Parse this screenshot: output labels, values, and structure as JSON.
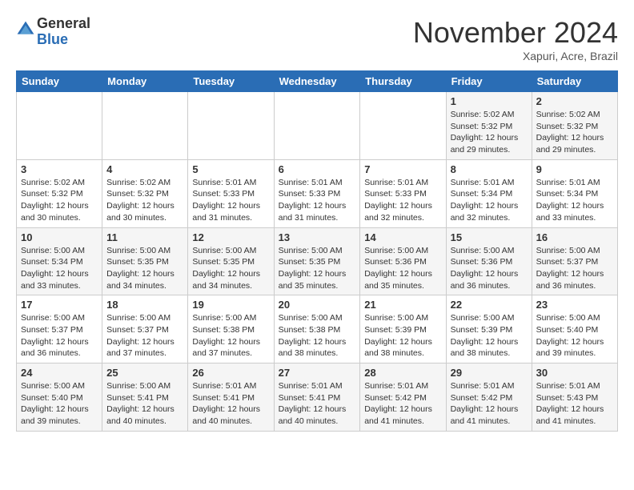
{
  "header": {
    "logo_general": "General",
    "logo_blue": "Blue",
    "month_title": "November 2024",
    "location": "Xapuri, Acre, Brazil"
  },
  "days_of_week": [
    "Sunday",
    "Monday",
    "Tuesday",
    "Wednesday",
    "Thursday",
    "Friday",
    "Saturday"
  ],
  "weeks": [
    [
      {
        "num": "",
        "info": ""
      },
      {
        "num": "",
        "info": ""
      },
      {
        "num": "",
        "info": ""
      },
      {
        "num": "",
        "info": ""
      },
      {
        "num": "",
        "info": ""
      },
      {
        "num": "1",
        "info": "Sunrise: 5:02 AM\nSunset: 5:32 PM\nDaylight: 12 hours and 29 minutes."
      },
      {
        "num": "2",
        "info": "Sunrise: 5:02 AM\nSunset: 5:32 PM\nDaylight: 12 hours and 29 minutes."
      }
    ],
    [
      {
        "num": "3",
        "info": "Sunrise: 5:02 AM\nSunset: 5:32 PM\nDaylight: 12 hours and 30 minutes."
      },
      {
        "num": "4",
        "info": "Sunrise: 5:02 AM\nSunset: 5:32 PM\nDaylight: 12 hours and 30 minutes."
      },
      {
        "num": "5",
        "info": "Sunrise: 5:01 AM\nSunset: 5:33 PM\nDaylight: 12 hours and 31 minutes."
      },
      {
        "num": "6",
        "info": "Sunrise: 5:01 AM\nSunset: 5:33 PM\nDaylight: 12 hours and 31 minutes."
      },
      {
        "num": "7",
        "info": "Sunrise: 5:01 AM\nSunset: 5:33 PM\nDaylight: 12 hours and 32 minutes."
      },
      {
        "num": "8",
        "info": "Sunrise: 5:01 AM\nSunset: 5:34 PM\nDaylight: 12 hours and 32 minutes."
      },
      {
        "num": "9",
        "info": "Sunrise: 5:01 AM\nSunset: 5:34 PM\nDaylight: 12 hours and 33 minutes."
      }
    ],
    [
      {
        "num": "10",
        "info": "Sunrise: 5:00 AM\nSunset: 5:34 PM\nDaylight: 12 hours and 33 minutes."
      },
      {
        "num": "11",
        "info": "Sunrise: 5:00 AM\nSunset: 5:35 PM\nDaylight: 12 hours and 34 minutes."
      },
      {
        "num": "12",
        "info": "Sunrise: 5:00 AM\nSunset: 5:35 PM\nDaylight: 12 hours and 34 minutes."
      },
      {
        "num": "13",
        "info": "Sunrise: 5:00 AM\nSunset: 5:35 PM\nDaylight: 12 hours and 35 minutes."
      },
      {
        "num": "14",
        "info": "Sunrise: 5:00 AM\nSunset: 5:36 PM\nDaylight: 12 hours and 35 minutes."
      },
      {
        "num": "15",
        "info": "Sunrise: 5:00 AM\nSunset: 5:36 PM\nDaylight: 12 hours and 36 minutes."
      },
      {
        "num": "16",
        "info": "Sunrise: 5:00 AM\nSunset: 5:37 PM\nDaylight: 12 hours and 36 minutes."
      }
    ],
    [
      {
        "num": "17",
        "info": "Sunrise: 5:00 AM\nSunset: 5:37 PM\nDaylight: 12 hours and 36 minutes."
      },
      {
        "num": "18",
        "info": "Sunrise: 5:00 AM\nSunset: 5:37 PM\nDaylight: 12 hours and 37 minutes."
      },
      {
        "num": "19",
        "info": "Sunrise: 5:00 AM\nSunset: 5:38 PM\nDaylight: 12 hours and 37 minutes."
      },
      {
        "num": "20",
        "info": "Sunrise: 5:00 AM\nSunset: 5:38 PM\nDaylight: 12 hours and 38 minutes."
      },
      {
        "num": "21",
        "info": "Sunrise: 5:00 AM\nSunset: 5:39 PM\nDaylight: 12 hours and 38 minutes."
      },
      {
        "num": "22",
        "info": "Sunrise: 5:00 AM\nSunset: 5:39 PM\nDaylight: 12 hours and 38 minutes."
      },
      {
        "num": "23",
        "info": "Sunrise: 5:00 AM\nSunset: 5:40 PM\nDaylight: 12 hours and 39 minutes."
      }
    ],
    [
      {
        "num": "24",
        "info": "Sunrise: 5:00 AM\nSunset: 5:40 PM\nDaylight: 12 hours and 39 minutes."
      },
      {
        "num": "25",
        "info": "Sunrise: 5:00 AM\nSunset: 5:41 PM\nDaylight: 12 hours and 40 minutes."
      },
      {
        "num": "26",
        "info": "Sunrise: 5:01 AM\nSunset: 5:41 PM\nDaylight: 12 hours and 40 minutes."
      },
      {
        "num": "27",
        "info": "Sunrise: 5:01 AM\nSunset: 5:41 PM\nDaylight: 12 hours and 40 minutes."
      },
      {
        "num": "28",
        "info": "Sunrise: 5:01 AM\nSunset: 5:42 PM\nDaylight: 12 hours and 41 minutes."
      },
      {
        "num": "29",
        "info": "Sunrise: 5:01 AM\nSunset: 5:42 PM\nDaylight: 12 hours and 41 minutes."
      },
      {
        "num": "30",
        "info": "Sunrise: 5:01 AM\nSunset: 5:43 PM\nDaylight: 12 hours and 41 minutes."
      }
    ]
  ]
}
